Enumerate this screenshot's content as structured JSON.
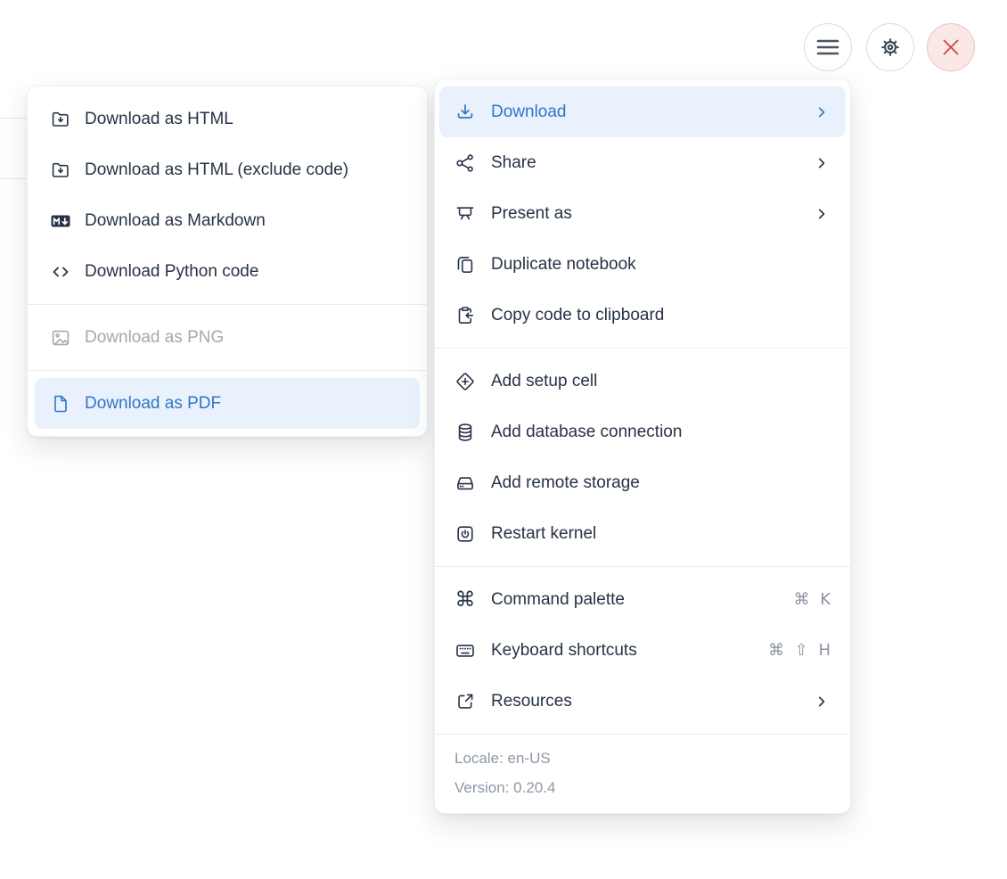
{
  "toolbar": {
    "buttons": [
      {
        "name": "hamburger-menu",
        "icon": "hamburger-icon"
      },
      {
        "name": "settings",
        "icon": "gear-icon"
      },
      {
        "name": "close",
        "icon": "close-icon",
        "accent": "#cf4a42",
        "bg": "#f9e8e6"
      }
    ]
  },
  "main_menu": {
    "highlight_color": "#e9f2fc",
    "accent_color": "#3274c8",
    "sections": [
      {
        "items": [
          {
            "label": "Download",
            "icon": "download-icon",
            "has_submenu": true,
            "state": "highlighted"
          },
          {
            "label": "Share",
            "icon": "share-icon",
            "has_submenu": true
          },
          {
            "label": "Present as",
            "icon": "presentation-icon",
            "has_submenu": true
          },
          {
            "label": "Duplicate notebook",
            "icon": "duplicate-icon"
          },
          {
            "label": "Copy code to clipboard",
            "icon": "clipboard-copy-icon"
          }
        ]
      },
      {
        "items": [
          {
            "label": "Add setup cell",
            "icon": "diamond-plus-icon"
          },
          {
            "label": "Add database connection",
            "icon": "database-icon"
          },
          {
            "label": "Add remote storage",
            "icon": "storage-drive-icon"
          },
          {
            "label": "Restart kernel",
            "icon": "power-icon"
          }
        ]
      },
      {
        "items": [
          {
            "label": "Command palette",
            "icon": "command-icon",
            "shortcut": "⌘ K"
          },
          {
            "label": "Keyboard shortcuts",
            "icon": "keyboard-icon",
            "shortcut": "⌘ ⇧ H"
          },
          {
            "label": "Resources",
            "icon": "external-link-icon",
            "has_submenu": true
          }
        ]
      }
    ],
    "footer": {
      "locale": "Locale: en-US",
      "version": "Version: 0.20.4"
    }
  },
  "download_submenu": {
    "sections": [
      {
        "items": [
          {
            "label": "Download as HTML",
            "icon": "folder-download-icon"
          },
          {
            "label": "Download as HTML (exclude code)",
            "icon": "folder-download-icon"
          },
          {
            "label": "Download as Markdown",
            "icon": "markdown-icon"
          },
          {
            "label": "Download Python code",
            "icon": "code-icon"
          }
        ]
      },
      {
        "items": [
          {
            "label": "Download as PNG",
            "icon": "image-icon",
            "state": "disabled"
          }
        ]
      },
      {
        "items": [
          {
            "label": "Download as PDF",
            "icon": "file-icon",
            "state": "highlighted"
          }
        ]
      }
    ]
  }
}
